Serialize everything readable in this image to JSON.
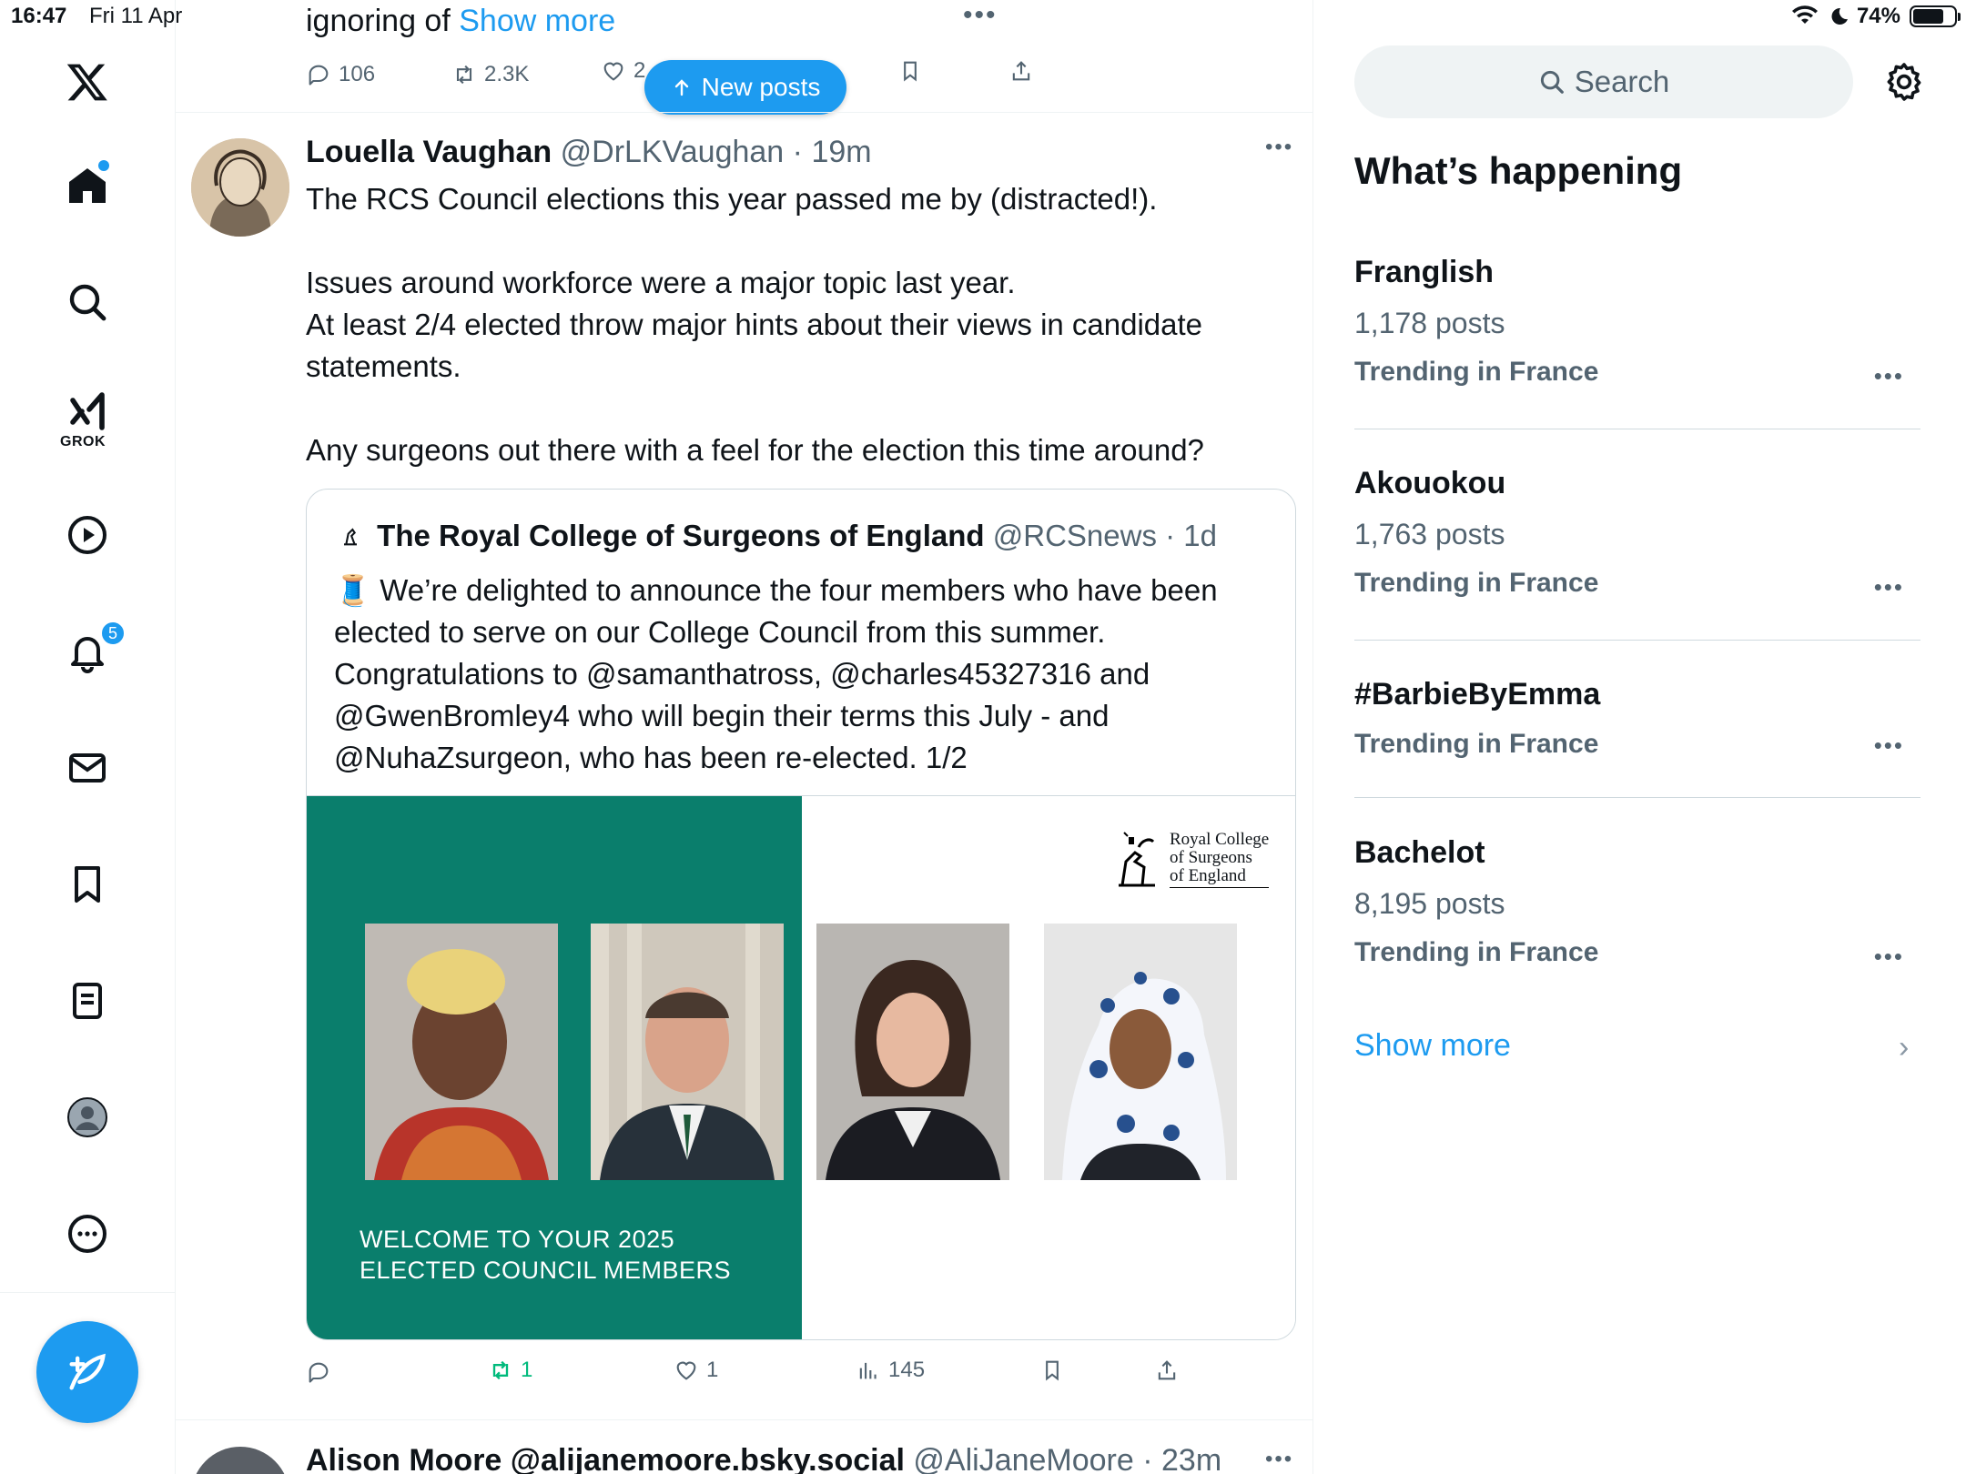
{
  "status_bar": {
    "time": "16:47",
    "date": "Fri 11 Apr",
    "battery": "74%"
  },
  "sidebar": {
    "items": [
      {
        "name": "home",
        "active": true
      },
      {
        "name": "explore"
      },
      {
        "name": "grok",
        "label": "GROK"
      },
      {
        "name": "video"
      },
      {
        "name": "notifications",
        "badge": "5"
      },
      {
        "name": "messages"
      },
      {
        "name": "bookmarks"
      },
      {
        "name": "lists"
      },
      {
        "name": "profile"
      },
      {
        "name": "more"
      }
    ]
  },
  "timeline": {
    "prev_post": {
      "text_prefix": "ignoring of",
      "show_more": "Show more",
      "replies": "106",
      "reposts": "2.3K",
      "likes": "2"
    },
    "new_posts_label": "New posts",
    "post": {
      "author_name": "Louella Vaughan",
      "handle": "@DrLKVaughan",
      "time": "19m",
      "paragraphs": [
        "The RCS Council elections this year passed me by (distracted!).",
        "Issues around workforce were a major topic last year.\nAt least 2/4  elected throw major hints about their views in candidate statements.",
        "Any surgeons out there with a feel for the election this time around?"
      ],
      "quote": {
        "author_name": "The Royal College of Surgeons of England",
        "handle": "@RCSnews",
        "time": "1d",
        "text": "🧵 We’re delighted to announce the four members who have been elected to serve on our College Council from this summer. Congratulations to @samanthatross, @charles45327316 and @GwenBromley4 who will begin their terms this July - and @NuhaZsurgeon, who has been re-elected. 1/2",
        "image": {
          "caption_line1": "WELCOME TO YOUR 2025",
          "caption_line2": "ELECTED COUNCIL MEMBERS",
          "logo_line1": "Royal College",
          "logo_line2": "of Surgeons",
          "logo_line3": "of England",
          "accent": "#0a7e6c"
        }
      },
      "actions": {
        "replies": "",
        "reposts": "1",
        "likes": "1",
        "views": "145"
      }
    },
    "next_post": {
      "author_name": "Alison Moore @alijanemoore.bsky.social",
      "handle": "@AliJaneMoore",
      "time": "23m"
    }
  },
  "right": {
    "search_placeholder": "Search",
    "title": "What’s happening",
    "trends": [
      {
        "name": "Franglish",
        "count": "1,178 posts",
        "location": "Trending in France"
      },
      {
        "name": "Akouokou",
        "count": "1,763 posts",
        "location": "Trending in France"
      },
      {
        "name": "#BarbieByEmma",
        "count": "",
        "location": "Trending in France"
      },
      {
        "name": "Bachelot",
        "count": "8,195 posts",
        "location": "Trending in France"
      }
    ],
    "show_more": "Show more"
  },
  "colors": {
    "accent": "#1d9bf0",
    "text": "#0f1419",
    "muted": "#536471",
    "repost_active": "#00ba7c"
  }
}
